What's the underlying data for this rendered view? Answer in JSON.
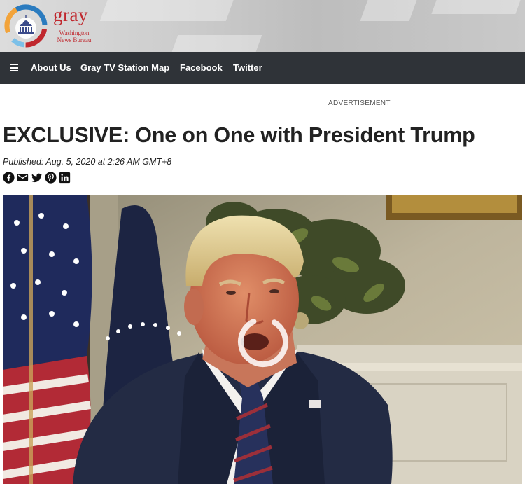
{
  "header": {
    "logo_word": "gray",
    "logo_sub_line1": "Washington",
    "logo_sub_line2": "News Bureau"
  },
  "nav": {
    "menu_icon": "hamburger-menu-icon",
    "links": [
      "About Us",
      "Gray TV Station Map",
      "Facebook",
      "Twitter"
    ]
  },
  "article": {
    "ad_label": "ADVERTISEMENT",
    "headline": "EXCLUSIVE: One on One with President Trump",
    "published": "Published: Aug. 5, 2020 at 2:26 AM GMT+8",
    "share_icons": [
      "facebook-icon",
      "email-icon",
      "twitter-icon",
      "pinterest-icon",
      "linkedin-icon"
    ]
  },
  "video": {
    "state": "loading",
    "spinner_icon": "loading-spinner-icon"
  },
  "colors": {
    "brand_red": "#c0282e",
    "nav_bg": "#2f3338",
    "headline": "#222222"
  }
}
